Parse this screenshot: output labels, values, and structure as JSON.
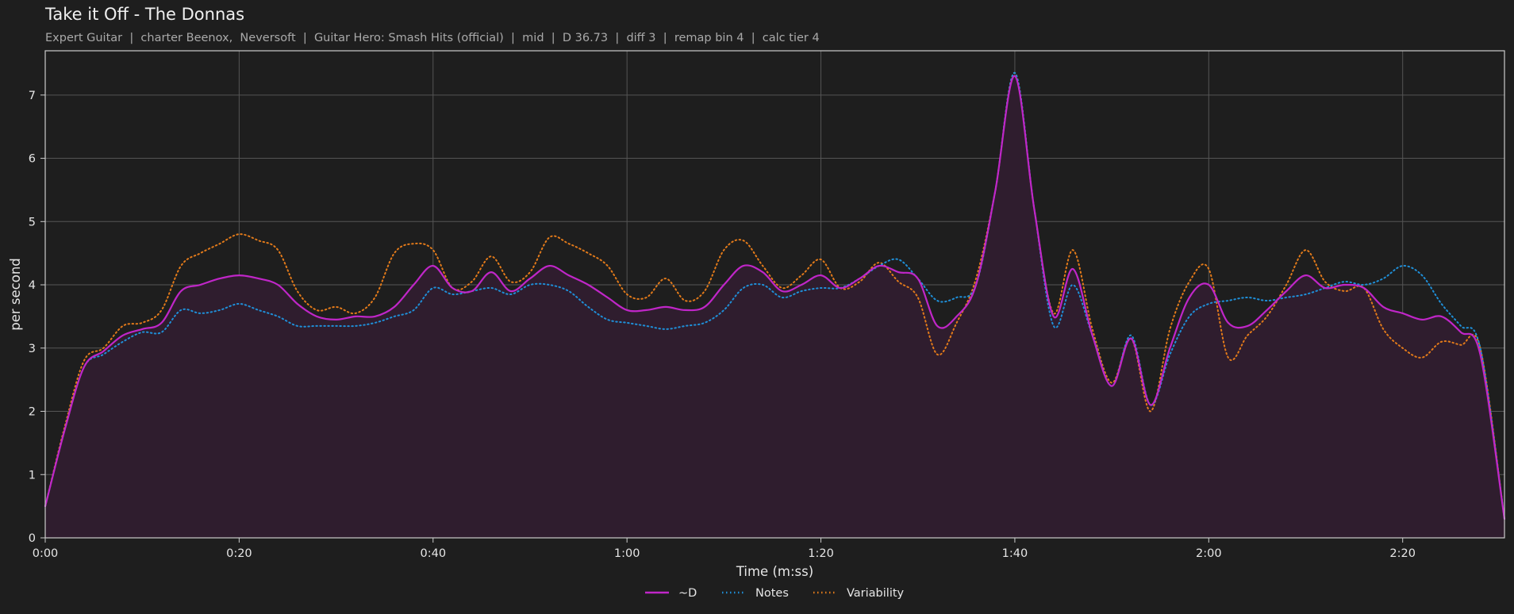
{
  "header": {
    "title": "Take it Off - The Donnas",
    "subtitle": "Expert Guitar  |  charter Beenox,  Neversoft  |  Guitar Hero: Smash Hits (official)  |  mid  |  D 36.73  |  diff 3  |  remap bin 4  |  calc tier 4"
  },
  "chart_data": {
    "type": "line",
    "title": "Take it Off - The Donnas",
    "xlabel": "Time (m:ss)",
    "ylabel": "per second",
    "xlim": [
      0,
      150.5
    ],
    "ylim": [
      0,
      7.7
    ],
    "x_ticks": [
      {
        "value": 0,
        "label": "0:00"
      },
      {
        "value": 20,
        "label": "0:20"
      },
      {
        "value": 40,
        "label": "0:40"
      },
      {
        "value": 60,
        "label": "1:00"
      },
      {
        "value": 80,
        "label": "1:20"
      },
      {
        "value": 100,
        "label": "1:40"
      },
      {
        "value": 120,
        "label": "2:00"
      },
      {
        "value": 140,
        "label": "2:20"
      }
    ],
    "y_ticks": [
      0,
      1,
      2,
      3,
      4,
      5,
      6,
      7
    ],
    "grid": true,
    "legend_position": "bottom-center",
    "colors": {
      "background": "#1e1e1e",
      "grid": "#555555",
      "axes": "#cccccc",
      "fill": "#2f1d2e"
    },
    "series": [
      {
        "name": "~D",
        "color": "#c026c8",
        "style": "solid",
        "x": [
          0,
          2,
          4,
          6,
          8,
          10,
          12,
          14,
          16,
          18,
          20,
          22,
          24,
          26,
          28,
          30,
          32,
          34,
          36,
          38,
          40,
          42,
          44,
          46,
          48,
          50,
          52,
          54,
          56,
          58,
          60,
          62,
          64,
          66,
          68,
          70,
          72,
          74,
          76,
          78,
          80,
          82,
          84,
          86,
          88,
          90,
          92,
          94,
          96,
          98,
          100,
          102,
          104,
          106,
          108,
          110,
          112,
          114,
          116,
          118,
          120,
          122,
          124,
          126,
          128,
          130,
          132,
          134,
          136,
          138,
          140,
          142,
          144,
          146,
          148,
          150.5
        ],
        "y": [
          0.5,
          1.7,
          2.7,
          2.95,
          3.2,
          3.3,
          3.4,
          3.9,
          4.0,
          4.1,
          4.15,
          4.1,
          4.0,
          3.7,
          3.5,
          3.45,
          3.5,
          3.5,
          3.65,
          4.0,
          4.3,
          3.95,
          3.9,
          4.2,
          3.9,
          4.1,
          4.3,
          4.15,
          4.0,
          3.8,
          3.6,
          3.6,
          3.65,
          3.6,
          3.65,
          4.0,
          4.3,
          4.2,
          3.9,
          4.0,
          4.15,
          3.95,
          4.1,
          4.3,
          4.2,
          4.1,
          3.35,
          3.5,
          4.0,
          5.5,
          7.3,
          5.2,
          3.5,
          4.25,
          3.2,
          2.4,
          3.15,
          2.1,
          3.0,
          3.8,
          4.0,
          3.4,
          3.35,
          3.6,
          3.9,
          4.15,
          3.95,
          4.0,
          3.95,
          3.65,
          3.55,
          3.45,
          3.5,
          3.25,
          2.9,
          0.3
        ]
      },
      {
        "name": "Notes",
        "color": "#1f8fd8",
        "style": "dotted",
        "x": [
          0,
          2,
          4,
          6,
          8,
          10,
          12,
          14,
          16,
          18,
          20,
          22,
          24,
          26,
          28,
          30,
          32,
          34,
          36,
          38,
          40,
          42,
          44,
          46,
          48,
          50,
          52,
          54,
          56,
          58,
          60,
          62,
          64,
          66,
          68,
          70,
          72,
          74,
          76,
          78,
          80,
          82,
          84,
          86,
          88,
          90,
          92,
          94,
          96,
          98,
          100,
          102,
          104,
          106,
          108,
          110,
          112,
          114,
          116,
          118,
          120,
          122,
          124,
          126,
          128,
          130,
          132,
          134,
          136,
          138,
          140,
          142,
          144,
          146,
          148,
          150.5
        ],
        "y": [
          0.5,
          1.7,
          2.7,
          2.9,
          3.1,
          3.25,
          3.25,
          3.6,
          3.55,
          3.6,
          3.7,
          3.6,
          3.5,
          3.35,
          3.35,
          3.35,
          3.35,
          3.4,
          3.5,
          3.6,
          3.95,
          3.85,
          3.9,
          3.95,
          3.85,
          4.0,
          4.0,
          3.9,
          3.65,
          3.45,
          3.4,
          3.35,
          3.3,
          3.35,
          3.4,
          3.6,
          3.95,
          4.0,
          3.8,
          3.9,
          3.95,
          3.95,
          4.1,
          4.3,
          4.4,
          4.1,
          3.75,
          3.8,
          4.0,
          5.5,
          7.35,
          5.2,
          3.35,
          4.0,
          3.2,
          2.4,
          3.2,
          2.1,
          2.9,
          3.5,
          3.7,
          3.75,
          3.8,
          3.75,
          3.8,
          3.85,
          3.95,
          4.05,
          4.0,
          4.1,
          4.3,
          4.15,
          3.7,
          3.35,
          3.0,
          0.3
        ]
      },
      {
        "name": "Variability",
        "color": "#e27a1a",
        "style": "dotted",
        "x": [
          0,
          2,
          4,
          6,
          8,
          10,
          12,
          14,
          16,
          18,
          20,
          22,
          24,
          26,
          28,
          30,
          32,
          34,
          36,
          38,
          40,
          42,
          44,
          46,
          48,
          50,
          52,
          54,
          56,
          58,
          60,
          62,
          64,
          66,
          68,
          70,
          72,
          74,
          76,
          78,
          80,
          82,
          84,
          86,
          88,
          90,
          92,
          94,
          96,
          98,
          100,
          102,
          104,
          106,
          108,
          110,
          112,
          114,
          116,
          118,
          120,
          122,
          124,
          126,
          128,
          130,
          132,
          134,
          136,
          138,
          140,
          142,
          144,
          146,
          148,
          150.5
        ],
        "y": [
          0.5,
          1.75,
          2.8,
          3.0,
          3.35,
          3.4,
          3.6,
          4.3,
          4.5,
          4.65,
          4.8,
          4.7,
          4.55,
          3.9,
          3.6,
          3.65,
          3.55,
          3.8,
          4.5,
          4.65,
          4.55,
          3.95,
          4.05,
          4.45,
          4.05,
          4.2,
          4.75,
          4.65,
          4.5,
          4.3,
          3.85,
          3.8,
          4.1,
          3.75,
          3.9,
          4.55,
          4.7,
          4.3,
          3.95,
          4.15,
          4.4,
          3.95,
          4.05,
          4.35,
          4.05,
          3.8,
          2.9,
          3.4,
          4.1,
          5.5,
          7.35,
          5.2,
          3.55,
          4.55,
          3.3,
          2.45,
          3.15,
          2.0,
          3.3,
          4.05,
          4.25,
          2.85,
          3.2,
          3.5,
          4.0,
          4.55,
          4.05,
          3.9,
          3.95,
          3.3,
          3.0,
          2.85,
          3.1,
          3.05,
          3.0,
          0.3
        ]
      }
    ]
  }
}
